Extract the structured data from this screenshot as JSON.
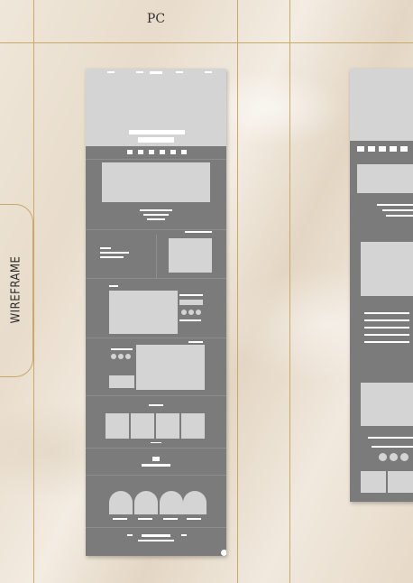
{
  "header": {
    "label": "PC"
  },
  "side_tab": {
    "label": "WIREFRAME"
  },
  "colors": {
    "guide": "#c9a96b",
    "wireframe_bg": "#7b7b7b",
    "placeholder": "#d4d4d4"
  }
}
